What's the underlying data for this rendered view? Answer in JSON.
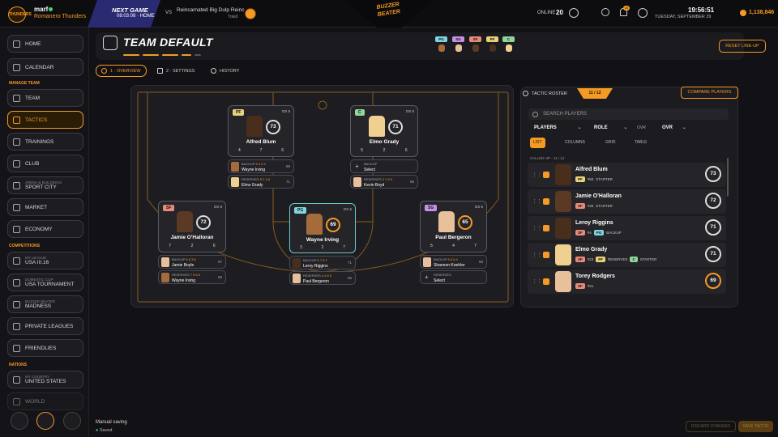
{
  "topbar": {
    "logo_text": "THUNDERS",
    "user": "marf",
    "team": "Romanero Thunders",
    "next_game_title": "NEXT GAME",
    "next_game_time": "08:03:08 · HOME",
    "vs": "VS",
    "opponent": "Reincarnated Big Dulp Reinc",
    "opponent_venue": "Trakit",
    "brand_line1": "BUZZER",
    "brand_line2": "BEATER",
    "online_label": "ONLINE",
    "online_count": "20",
    "notif_count": "10",
    "clock": "19:56:51",
    "date": "TUESDAY, SEPTEMBER 29",
    "money": "1,138,846"
  },
  "sidebar": {
    "home": "HOME",
    "calendar": "CALENDAR",
    "manage_team": "MANAGE TEAM",
    "team": "TEAM",
    "tactics": "TACTICS",
    "trainings": "TRAININGS",
    "club": "CLUB",
    "arena_sub": "ARENA & BUILDINGS",
    "arena_main": "SPORT CITY",
    "market": "MARKET",
    "economy": "ECONOMY",
    "competitions": "COMPETITIONS",
    "league_sub": "MY LEAGUE",
    "league_main": "USA III.16",
    "cup_sub": "DOMESTIC CUP",
    "cup_main": "USA TOURNAMENT",
    "bb_sub": "BUZZER BEATER",
    "bb_main": "MADNESS",
    "private": "PRIVATE LEAGUES",
    "friendlies": "FRIENDLIES",
    "nations": "NATIONS",
    "country_sub": "MY COUNTRY",
    "country_main": "UNITED STATES",
    "world": "WORLD"
  },
  "header": {
    "title": "TEAM DEFAULT",
    "positions": [
      "PG",
      "SG",
      "SF",
      "PF",
      "C"
    ],
    "reset": "RESET LINE-UP"
  },
  "tabs": [
    "1 · OVERVIEW",
    "2 · SETTINGS",
    "HISTORY"
  ],
  "court": {
    "players": [
      {
        "pos": "PF",
        "ovr": "OS 5",
        "rating": "73",
        "rlabel": "OVR",
        "name": "Alfred Blum",
        "stats": [
          "4",
          "7",
          "6"
        ],
        "backup_label": "BACKUP",
        "backup_nums": "5 5 6 4",
        "backup_name": "Wayne Irving",
        "backup_ovr": "69",
        "reserves_label": "RESERVES",
        "reserves_nums": "5 2 4 6",
        "reserves_name": "Elmo Grady",
        "reserves_ovr": "71"
      },
      {
        "pos": "C",
        "ovr": "OS 5",
        "rating": "71",
        "rlabel": "OVR",
        "name": "Elmo Grady",
        "stats": [
          "5",
          "2",
          "6"
        ],
        "backup_label": "BACKUP",
        "backup_nums": "",
        "backup_name": "Select",
        "backup_ovr": "",
        "reserves_label": "RESERVES",
        "reserves_nums": "2 1 5 5",
        "reserves_name": "Kevin Boyd",
        "reserves_ovr": "65"
      },
      {
        "pos": "SF",
        "ovr": "OS 6",
        "rating": "72",
        "rlabel": "OVR",
        "name": "Jamie O'Halloran",
        "stats": [
          "7",
          "2",
          "6"
        ],
        "backup_label": "BACKUP",
        "backup_nums": "5 5 3 6",
        "backup_name": "Jamie Boyle",
        "backup_ovr": "67",
        "reserves_label": "RESERVES",
        "reserves_nums": "7 5 6 5",
        "reserves_name": "Wayne Irving",
        "reserves_ovr": "69"
      },
      {
        "pos": "PG",
        "ovr": "OS 6",
        "rating": "69",
        "rlabel": "OVR",
        "name": "Wayne Irving",
        "stats": [
          "3",
          "2",
          "7"
        ],
        "backup_label": "BACKUP",
        "backup_nums": "6 7 5 7",
        "backup_name": "Leroy Riggins",
        "backup_ovr": "71",
        "reserves_label": "RESERVES",
        "reserves_nums": "4 4 6 5",
        "reserves_name": "Paul Bergeron",
        "reserves_ovr": "65"
      },
      {
        "pos": "SG",
        "ovr": "OS 6",
        "rating": "65",
        "rlabel": "OVR",
        "name": "Paul Bergeron",
        "stats": [
          "5",
          "4",
          "7"
        ],
        "backup_label": "BACKUP",
        "backup_nums": "5 5 6 4",
        "backup_name": "Shannon Koehler",
        "backup_ovr": "69",
        "reserves_label": "RESERVES",
        "reserves_nums": "",
        "reserves_name": "Select",
        "reserves_ovr": ""
      }
    ]
  },
  "roster": {
    "tab_label": "TACTIC ROSTER",
    "count": "11 / 12",
    "compare": "COMPARE PLAYERS",
    "search_placeholder": "SEARCH PLAYERS",
    "filters": [
      "PLAYERS",
      "ROLE",
      "OVR",
      "OVR"
    ],
    "views": [
      "LIST",
      "COLUMNS",
      "GRID",
      "TABLE"
    ],
    "called_up": "CALLED UP · 11 / 12",
    "rows": [
      {
        "name": "Alfred Blum",
        "tag": "PF",
        "num": "#50",
        "role": "STARTER",
        "tag2": "",
        "role2": "",
        "rating": "73"
      },
      {
        "name": "Jamie O'Halloran",
        "tag": "SF",
        "num": "#45",
        "role": "STARTER",
        "tag2": "",
        "role2": "",
        "rating": "72"
      },
      {
        "name": "Leroy Riggins",
        "tag": "SF",
        "num": "#4",
        "role": "",
        "tag2": "PG",
        "role2": "BACKUP",
        "rating": "71"
      },
      {
        "name": "Elmo Grady",
        "tag": "SF",
        "num": "#23",
        "role": "",
        "tag2": "PF",
        "role2": "RESERVES",
        "tag3": "C",
        "role3": "STARTER",
        "rating": "71"
      },
      {
        "name": "Torey Rodgers",
        "tag": "SF",
        "num": "#21",
        "role": "",
        "tag2": "",
        "role2": "",
        "rating": "69"
      }
    ]
  },
  "footer": {
    "title": "Manual saving",
    "status": "Saved",
    "discard": "DISCARD CHANGES",
    "save": "SAVE TACTIC"
  },
  "colors": {
    "accent": "#f59a23",
    "pos_pg": "#7fd6e0",
    "pos_sg": "#c792e6",
    "pos_sf": "#e88a7a",
    "pos_pf": "#e8d27a",
    "pos_c": "#8fd69a"
  }
}
